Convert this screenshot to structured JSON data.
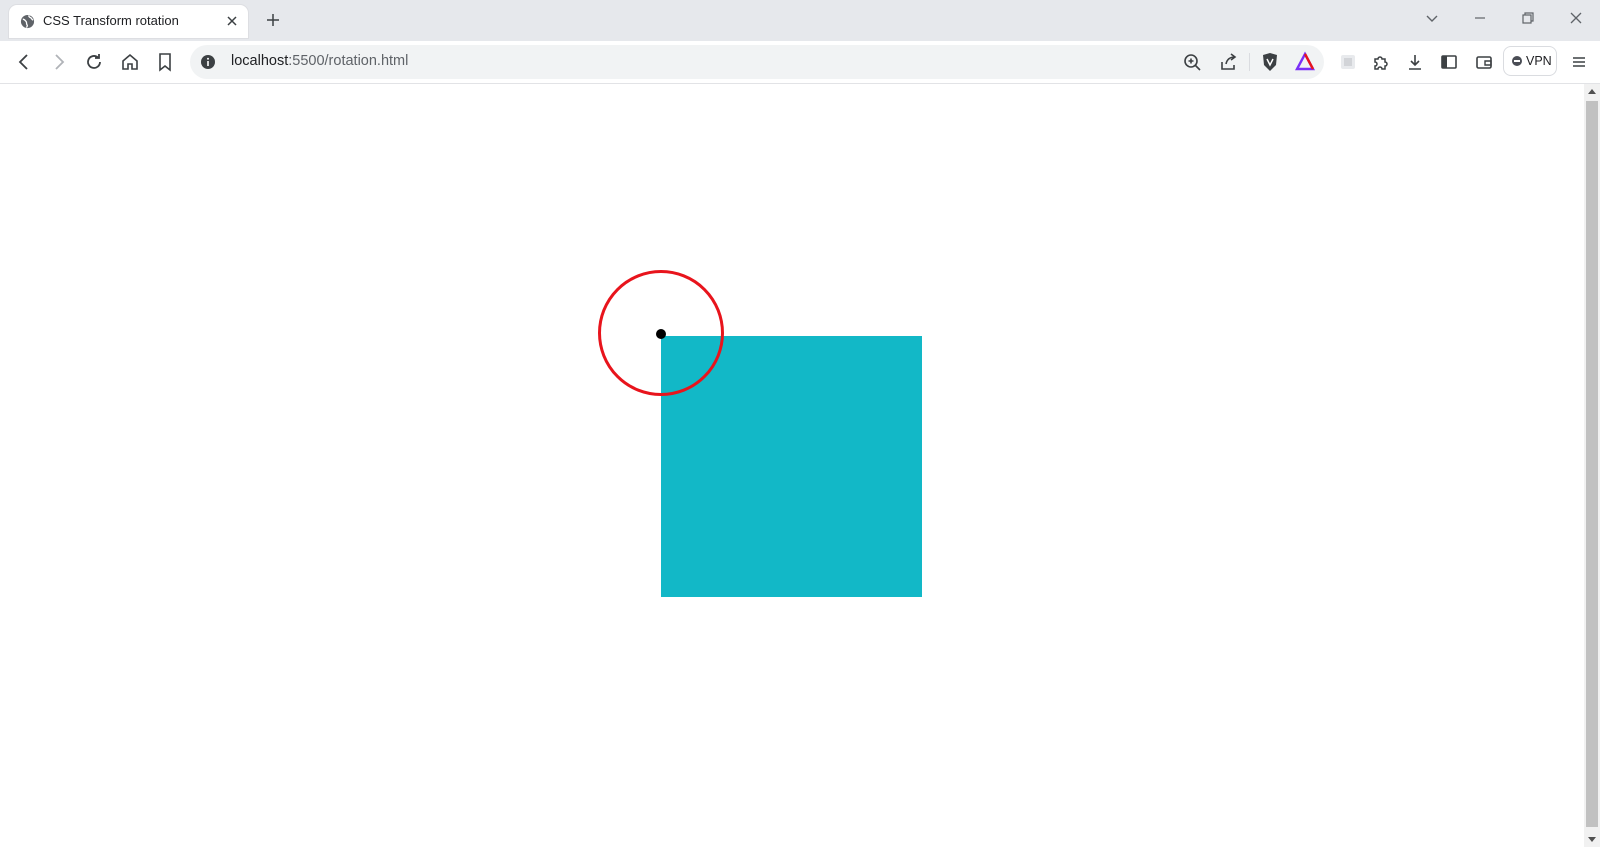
{
  "tab": {
    "title": "CSS Transform rotation",
    "favicon": "globe-icon"
  },
  "address_bar": {
    "host": "localhost",
    "path": ":5500/rotation.html"
  },
  "toolbar": {
    "vpn_label": "VPN"
  },
  "scene": {
    "square_color": "#12b8c7",
    "ring_color": "#e8141c",
    "pivot_color": "#000000"
  }
}
